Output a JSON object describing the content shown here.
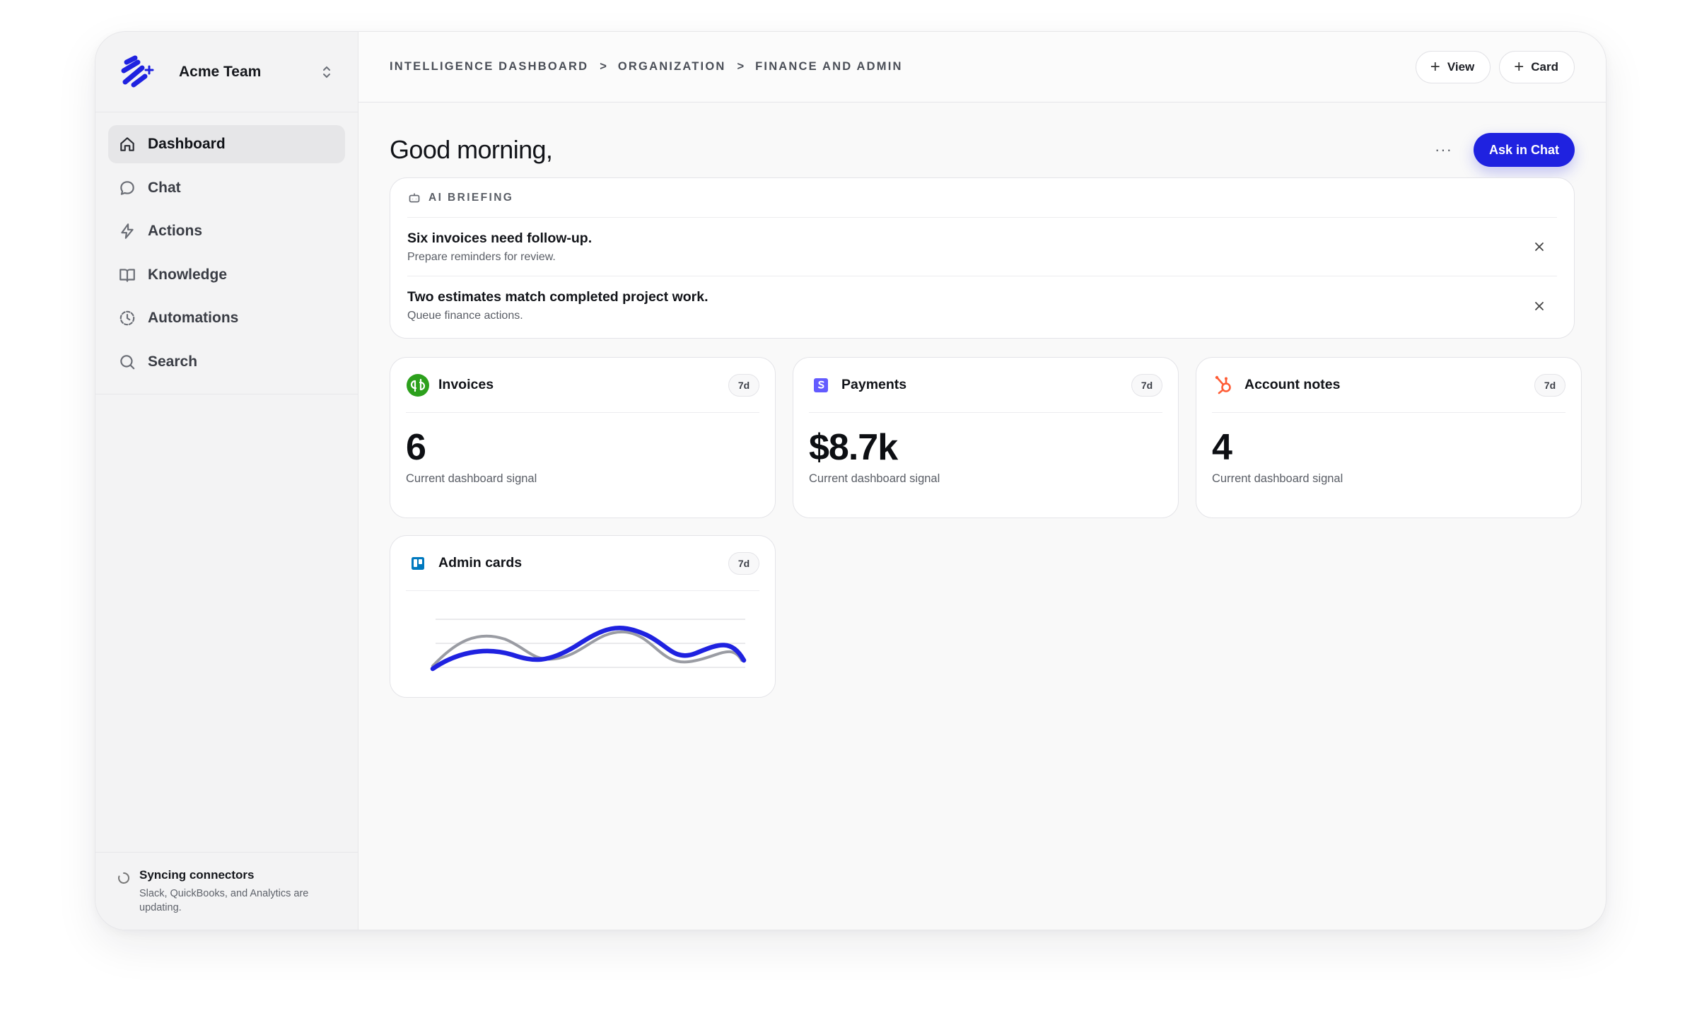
{
  "sidebar": {
    "team_name": "Acme Team",
    "items": [
      {
        "label": "Dashboard",
        "icon": "home-icon",
        "active": true
      },
      {
        "label": "Chat",
        "icon": "chat-bubble-icon",
        "active": false
      },
      {
        "label": "Actions",
        "icon": "lightning-icon",
        "active": false
      },
      {
        "label": "Knowledge",
        "icon": "book-icon",
        "active": false
      },
      {
        "label": "Automations",
        "icon": "clock-dashed-icon",
        "active": false
      },
      {
        "label": "Search",
        "icon": "search-icon",
        "active": false
      }
    ],
    "sync": {
      "title": "Syncing connectors",
      "desc": "Slack, QuickBooks, and Analytics are updating."
    }
  },
  "header": {
    "breadcrumb": [
      "INTELLIGENCE DASHBOARD",
      "ORGANIZATION",
      "FINANCE AND ADMIN"
    ],
    "separator": ">",
    "view_label": "View",
    "card_label": "Card"
  },
  "greeting": "Good morning,",
  "more_label": "···",
  "ask_label": "Ask in Chat",
  "briefing": {
    "heading": "AI BRIEFING",
    "items": [
      {
        "title": "Six invoices need follow-up.",
        "subtitle": "Prepare reminders for review."
      },
      {
        "title": "Two estimates match completed project work.",
        "subtitle": "Queue finance actions."
      }
    ]
  },
  "cards": [
    {
      "title": "Invoices",
      "badge": "7d",
      "value": "6",
      "subtitle": "Current dashboard signal",
      "icon": "quickbooks-icon"
    },
    {
      "title": "Payments",
      "badge": "7d",
      "value": "$8.7k",
      "subtitle": "Current dashboard signal",
      "icon": "stripe-icon"
    },
    {
      "title": "Account notes",
      "badge": "7d",
      "value": "4",
      "subtitle": "Current dashboard signal",
      "icon": "hubspot-icon"
    },
    {
      "title": "Admin cards",
      "badge": "7d",
      "icon": "trello-icon"
    }
  ],
  "colors": {
    "accent": "#1f22e0",
    "quickbooks": "#2ca01c",
    "stripe": "#635bff",
    "hubspot": "#ff5c35",
    "trello": "#0079bf",
    "series_gray": "#9a9ca3"
  }
}
